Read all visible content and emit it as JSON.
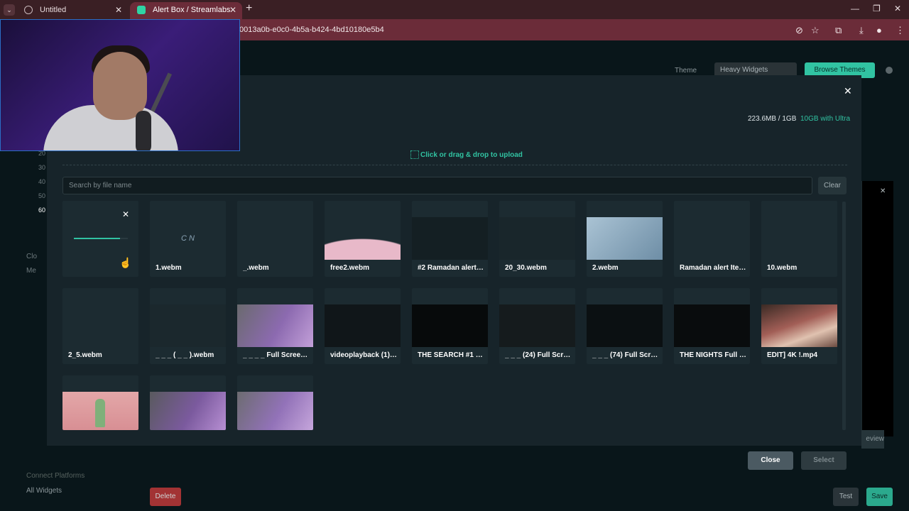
{
  "browser": {
    "tabs": [
      {
        "title": "Untitled",
        "close": "✕"
      },
      {
        "title": "Alert Box / Streamlabs",
        "close": "✕"
      }
    ],
    "new_tab": "+",
    "url": "0013a0b-e0c0-4b5a-b424-4bd10180e5b4"
  },
  "background_page": {
    "theme_label": "Theme",
    "theme_value": "Heavy Widgets",
    "browse_themes": "Browse Themes",
    "numbers": [
      "20",
      "30",
      "40",
      "50",
      "60"
    ],
    "side_clo": "Clo",
    "side_me": "Me",
    "connect_platforms": "Connect Platforms",
    "all_widgets": "All Widgets",
    "review": "eview",
    "delete": "Delete",
    "test": "Test",
    "save": "Save"
  },
  "modal": {
    "close_icon": "✕",
    "storage_used": "223.6MB / 1GB",
    "storage_upgrade": "10GB with Ultra",
    "upload_label": "Click or drag & drop to upload",
    "search_placeholder": "Search by file name",
    "clear_label": "Clear",
    "upload_progress": 0.85,
    "files": [
      {
        "name": "1.webm"
      },
      {
        "name": "_.webm"
      },
      {
        "name": "free2.webm"
      },
      {
        "name": "#2 Ramadan alert w..."
      },
      {
        "name": "20_30.webm"
      },
      {
        "name": "2.webm"
      },
      {
        "name": "Ramadan alert Item..."
      },
      {
        "name": "10.webm"
      },
      {
        "name": "2_5.webm"
      },
      {
        "name": "_ _ _ ( _ _ ).webm"
      },
      {
        "name": "_ _ _ _ Full Screen Al..."
      },
      {
        "name": "videoplayback (1)...."
      },
      {
        "name": "THE SEARCH #1 [A..."
      },
      {
        "name": "_ _ _ (24) Full Scree..."
      },
      {
        "name": "_ _ _ (74) Full Scree..."
      },
      {
        "name": "THE NIGHTS Full Sc..."
      },
      {
        "name": "EDIT] 4K !.mp4"
      }
    ],
    "close_button": "Close",
    "select_button": "Select"
  }
}
